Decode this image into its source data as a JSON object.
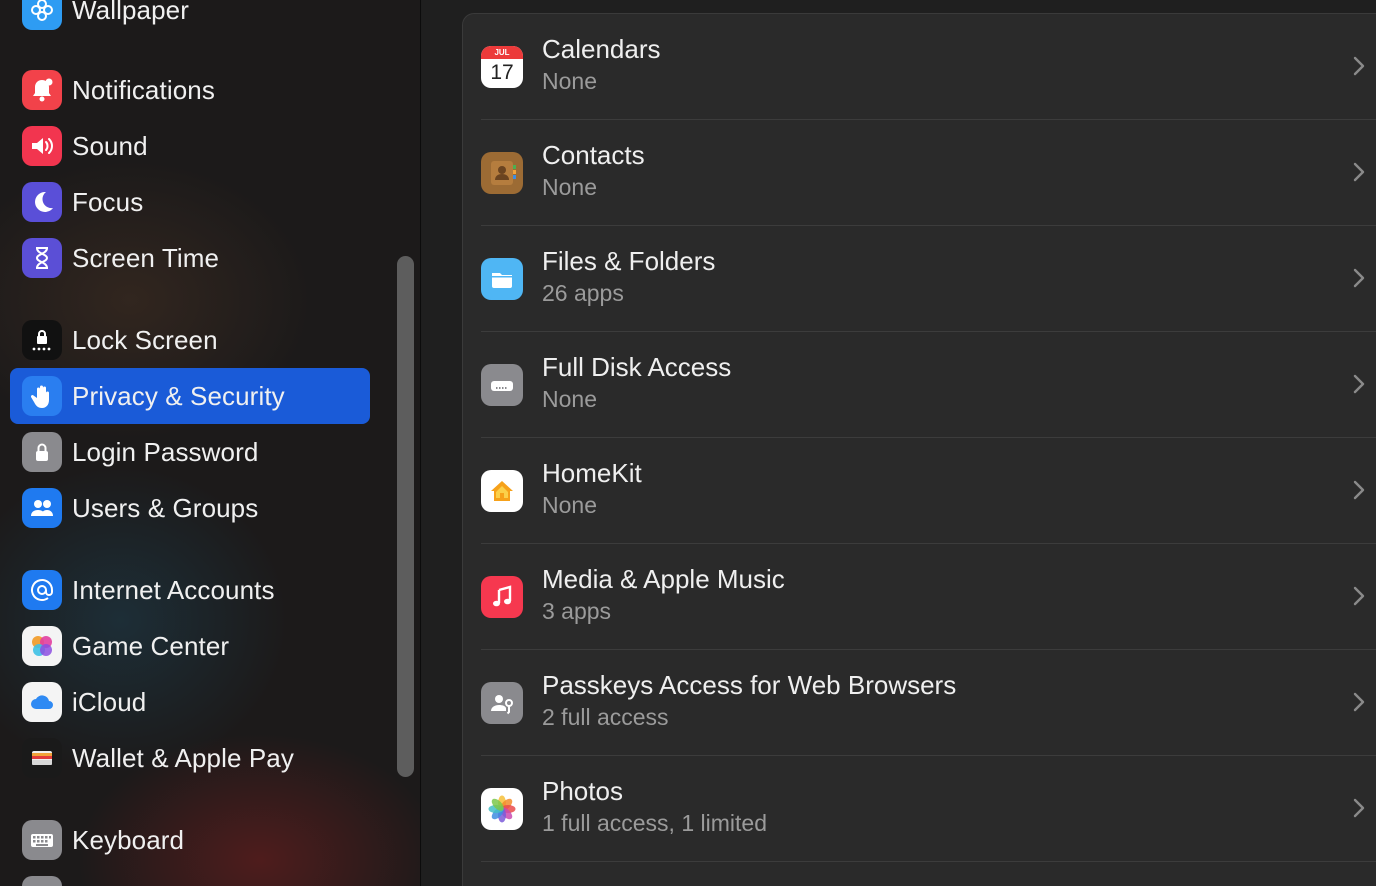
{
  "sidebar": {
    "items": [
      {
        "label": "Wallpaper",
        "icon": "wallpaper-icon"
      },
      {
        "label": "Notifications",
        "icon": "bell-icon"
      },
      {
        "label": "Sound",
        "icon": "speaker-icon"
      },
      {
        "label": "Focus",
        "icon": "moon-icon"
      },
      {
        "label": "Screen Time",
        "icon": "hourglass-icon"
      },
      {
        "label": "Lock Screen",
        "icon": "lock-screen-icon"
      },
      {
        "label": "Privacy & Security",
        "icon": "hand-icon",
        "selected": true
      },
      {
        "label": "Login Password",
        "icon": "padlock-icon"
      },
      {
        "label": "Users & Groups",
        "icon": "users-icon"
      },
      {
        "label": "Internet Accounts",
        "icon": "at-sign-icon"
      },
      {
        "label": "Game Center",
        "icon": "game-center-icon"
      },
      {
        "label": "iCloud",
        "icon": "cloud-icon"
      },
      {
        "label": "Wallet & Apple Pay",
        "icon": "wallet-icon"
      },
      {
        "label": "Keyboard",
        "icon": "keyboard-icon"
      }
    ]
  },
  "main": {
    "rows": [
      {
        "title": "Calendars",
        "subtitle": "None",
        "icon": "calendar-icon",
        "calendar_month": "JUL",
        "calendar_day": "17"
      },
      {
        "title": "Contacts",
        "subtitle": "None",
        "icon": "contacts-icon"
      },
      {
        "title": "Files & Folders",
        "subtitle": "26 apps",
        "icon": "folder-icon"
      },
      {
        "title": "Full Disk Access",
        "subtitle": "None",
        "icon": "disk-icon"
      },
      {
        "title": "HomeKit",
        "subtitle": "None",
        "icon": "home-icon"
      },
      {
        "title": "Media & Apple Music",
        "subtitle": "3 apps",
        "icon": "music-note-icon"
      },
      {
        "title": "Passkeys Access for Web Browsers",
        "subtitle": "2 full access",
        "icon": "passkey-icon"
      },
      {
        "title": "Photos",
        "subtitle": "1 full access, 1 limited",
        "icon": "photos-icon"
      }
    ]
  },
  "colors": {
    "selection": "#1a5bd8",
    "window_bg": "#1f1f1f",
    "panel_bg": "#2a2a2a"
  }
}
